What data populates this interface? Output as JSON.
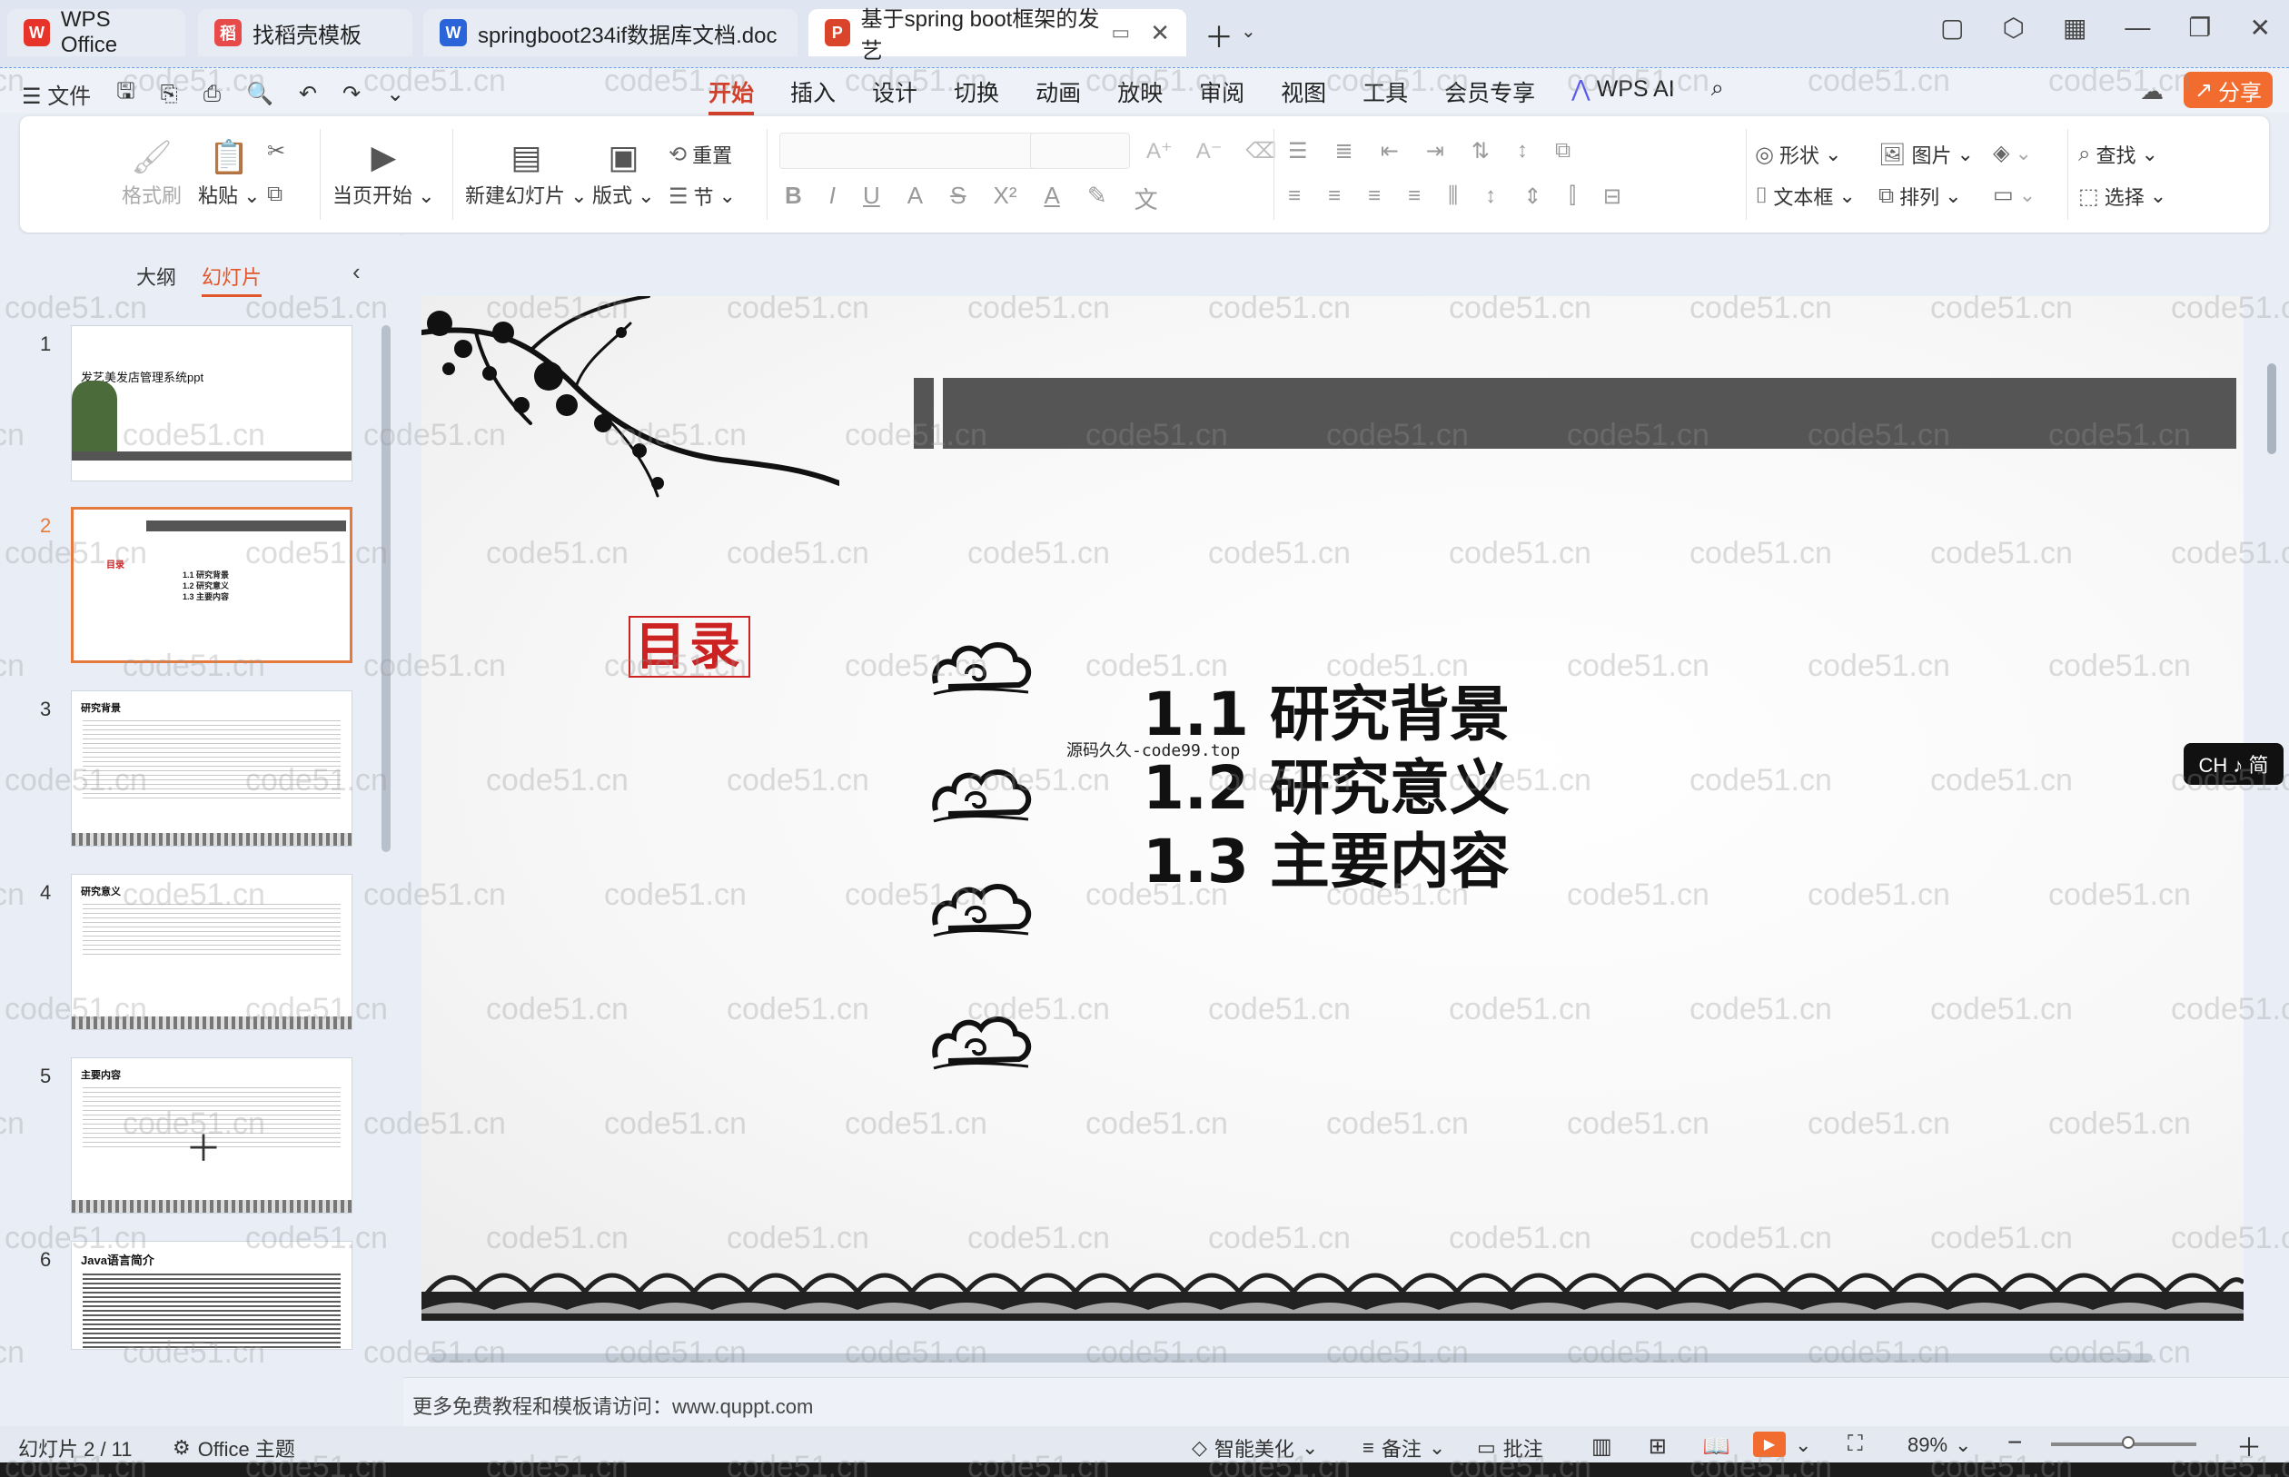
{
  "tabs": [
    {
      "label": "WPS Office",
      "icon": "wps-logo-icon",
      "color": "#e8332a"
    },
    {
      "label": "找稻壳模板",
      "icon": "daoke-icon",
      "color": "#e84a4a"
    },
    {
      "label": "springboot234if数据库文档.doc",
      "icon": "word-doc-icon",
      "color": "#2b63d9"
    },
    {
      "label": "基于spring boot框架的发艺",
      "icon": "ppt-icon",
      "color": "#d9442a"
    }
  ],
  "menu": {
    "file": "文件",
    "tabs": [
      "开始",
      "插入",
      "设计",
      "切换",
      "动画",
      "放映",
      "审阅",
      "视图",
      "工具",
      "会员专享"
    ],
    "wps_ai": "WPS AI",
    "share": "分享"
  },
  "ribbon": {
    "format_painter": "格式刷",
    "paste": "粘贴",
    "play_from_current": "当页开始",
    "new_slide": "新建幻灯片",
    "layout": "版式",
    "reset": "重置",
    "section": "节",
    "shape": "形状",
    "image": "图片",
    "textbox": "文本框",
    "arrange": "排列",
    "find": "查找",
    "select": "选择"
  },
  "panel": {
    "outline_tab": "大纲",
    "slides_tab": "幻灯片",
    "thumbs": [
      {
        "num": "1",
        "title": "发艺美发店管理系统ppt"
      },
      {
        "num": "2",
        "title": "目录"
      },
      {
        "num": "3",
        "title": "研究背景"
      },
      {
        "num": "4",
        "title": "研究意义"
      },
      {
        "num": "5",
        "title": "主要内容"
      },
      {
        "num": "6",
        "title": "Java语言简介"
      }
    ]
  },
  "slide": {
    "mulu": "目录",
    "items": [
      {
        "num": "1.1",
        "text": "研究背景"
      },
      {
        "num": "1.2",
        "text": "研究意义"
      },
      {
        "num": "1.3",
        "text": "主要内容"
      }
    ],
    "source_note": "源码久久-code99.top"
  },
  "notes": "更多免费教程和模板请访问：www.quppt.com",
  "ime": "CH ♪ 简",
  "status": {
    "slide_count": "幻灯片 2 / 11",
    "theme": "Office 主题",
    "beautify": "智能美化",
    "notes": "备注",
    "comments": "批注",
    "zoom": "89%"
  },
  "watermark": "code51.cn"
}
